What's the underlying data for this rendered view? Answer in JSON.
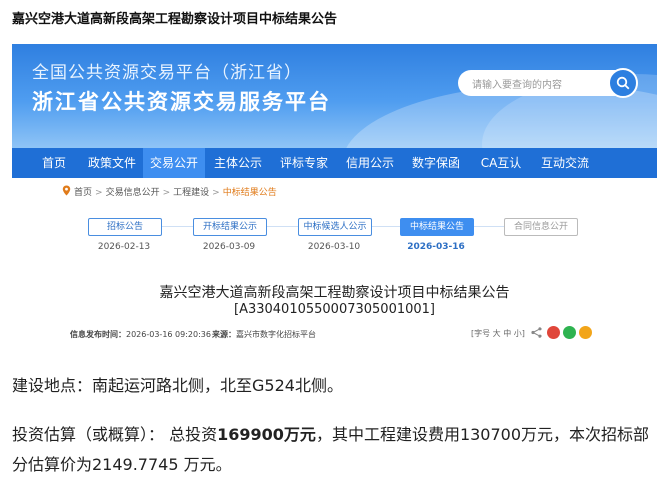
{
  "page_title": "嘉兴空港大道高新段高架工程勘察设计项目中标结果公告",
  "site": {
    "subtitle": "全国公共资源交易平台（浙江省）",
    "title": "浙江省公共资源交易服务平台",
    "search_placeholder": "请输入要查询的内容"
  },
  "nav": [
    {
      "label": "首页"
    },
    {
      "label": "政策文件"
    },
    {
      "label": "交易公开",
      "active": true
    },
    {
      "label": "主体公示"
    },
    {
      "label": "评标专家"
    },
    {
      "label": "信用公示"
    },
    {
      "label": "数字保函"
    },
    {
      "label": "CA互认"
    },
    {
      "label": "互动交流"
    }
  ],
  "breadcrumb": [
    "首页",
    "交易信息公开",
    "工程建设",
    "中标结果公告"
  ],
  "steps": [
    {
      "label": "招标公告",
      "date": "2026-02-13"
    },
    {
      "label": "开标结果公示",
      "date": "2026-03-09"
    },
    {
      "label": "中标候选人公示",
      "date": "2026-03-10"
    },
    {
      "label": "中标结果公告",
      "date": "2026-03-16",
      "active": true
    },
    {
      "label": "合同信息公开",
      "date": "",
      "disabled": true
    }
  ],
  "article": {
    "title": "嘉兴空港大道高新段高架工程勘察设计项目中标结果公告",
    "code": "[A3304010550007305001001]",
    "publish_label": "信息发布时间：",
    "publish_time": "2026-03-16 09:20:36",
    "source_label": "来源：",
    "source": "嘉兴市数字化招标平台",
    "font_size": "[字号 大 中 小]"
  },
  "body": {
    "location_label": "建设地点：",
    "location": "南起运河路北侧，北至G524北侧。",
    "investment_label": "投资估算（或概算）：",
    "investment_pre": "总投资",
    "investment_total": "169900万元",
    "investment_post": "，其中工程建设费用130700万元，本次招标部分估算价为2149.7745 万元。"
  },
  "colors": {
    "brand": "#1f6fd6",
    "accent": "#3e8ef0",
    "breadcrumb_current": "#e07b1a"
  }
}
